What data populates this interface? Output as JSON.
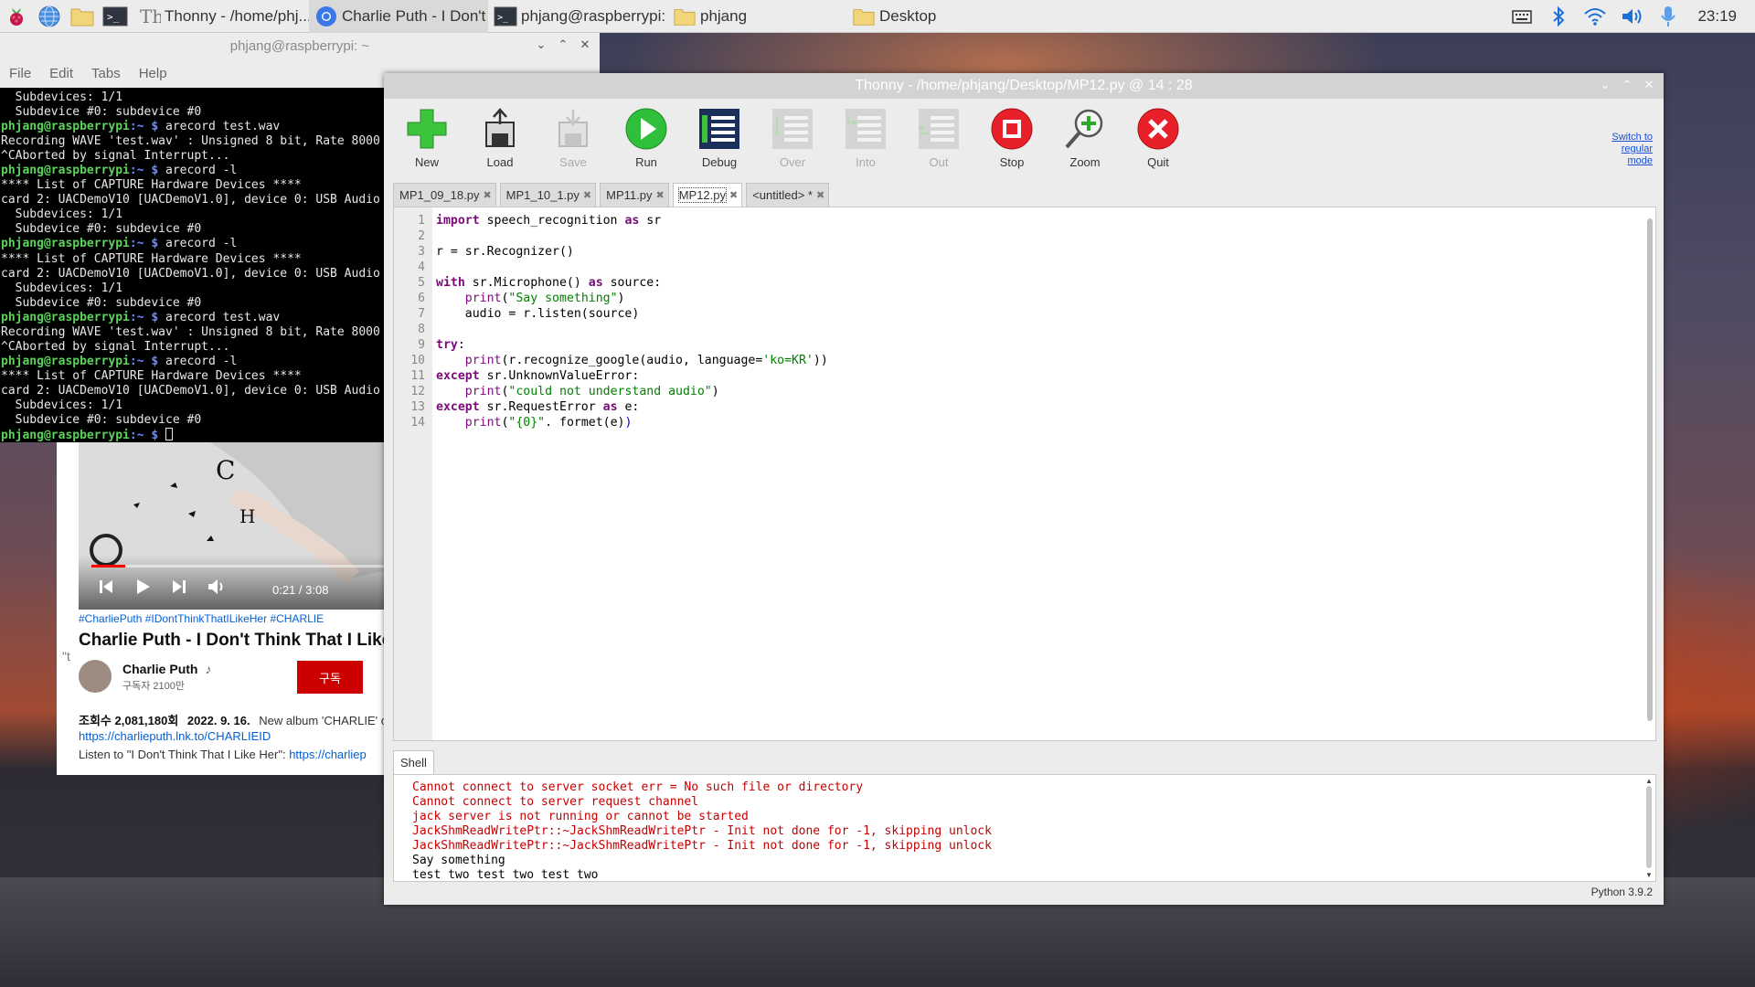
{
  "taskbar": {
    "tasks": [
      {
        "label": "Thonny  -  /home/phj..."
      },
      {
        "label": "Charlie Puth - I Don't ..."
      },
      {
        "label": "phjang@raspberrypi: ..."
      },
      {
        "label": "phjang"
      },
      {
        "label": "Desktop"
      }
    ],
    "clock": "23:19"
  },
  "terminal": {
    "title": "phjang@raspberrypi: ~",
    "menu": [
      "File",
      "Edit",
      "Tabs",
      "Help"
    ],
    "prompt_user": "phjang@raspberrypi",
    "prompt_path": ":~ $",
    "lines": [
      {
        "type": "out",
        "text": "  Subdevices: 1/1"
      },
      {
        "type": "out",
        "text": "  Subdevice #0: subdevice #0"
      },
      {
        "type": "cmd",
        "text": " arecord test.wav"
      },
      {
        "type": "out",
        "text": "Recording WAVE 'test.wav' : Unsigned 8 bit, Rate 8000"
      },
      {
        "type": "out",
        "text": "^CAborted by signal Interrupt..."
      },
      {
        "type": "cmd",
        "text": " arecord -l"
      },
      {
        "type": "out",
        "text": "**** List of CAPTURE Hardware Devices ****"
      },
      {
        "type": "out",
        "text": "card 2: UACDemoV10 [UACDemoV1.0], device 0: USB Audio"
      },
      {
        "type": "out",
        "text": "  Subdevices: 1/1"
      },
      {
        "type": "out",
        "text": "  Subdevice #0: subdevice #0"
      },
      {
        "type": "cmd",
        "text": " arecord -l"
      },
      {
        "type": "out",
        "text": "**** List of CAPTURE Hardware Devices ****"
      },
      {
        "type": "out",
        "text": "card 2: UACDemoV10 [UACDemoV1.0], device 0: USB Audio"
      },
      {
        "type": "out",
        "text": "  Subdevices: 1/1"
      },
      {
        "type": "out",
        "text": "  Subdevice #0: subdevice #0"
      },
      {
        "type": "cmd",
        "text": " arecord test.wav"
      },
      {
        "type": "out",
        "text": "Recording WAVE 'test.wav' : Unsigned 8 bit, Rate 8000"
      },
      {
        "type": "out",
        "text": "^CAborted by signal Interrupt..."
      },
      {
        "type": "cmd",
        "text": " arecord -l"
      },
      {
        "type": "out",
        "text": "**** List of CAPTURE Hardware Devices ****"
      },
      {
        "type": "out",
        "text": "card 2: UACDemoV10 [UACDemoV1.0], device 0: USB Audio"
      },
      {
        "type": "out",
        "text": "  Subdevices: 1/1"
      },
      {
        "type": "out",
        "text": "  Subdevice #0: subdevice #0"
      },
      {
        "type": "prompt",
        "text": " "
      }
    ]
  },
  "browser": {
    "video_time": "0:21 / 3:08",
    "video_progress_fraction": 0.11,
    "tags": "#CharliePuth #IDontThinkThatILikeHer #CHARLIE",
    "title": "Charlie Puth - I Don't Think That I Like H",
    "channel": "Charlie Puth",
    "channel_suffix": "♪",
    "subscribers": "구독자 2100만",
    "subscribe_label": "구독",
    "views": "조회수 2,081,180회",
    "date": "2022. 9. 16.",
    "desc_snippet": "New album 'CHARLIE' out",
    "link1": "https://charlieputh.lnk.to/CHARLIEID",
    "listen_prefix": "Listen to \"I Don't Think That I Like Her\": ",
    "link2": "https://charliep",
    "left_stub": "\"t"
  },
  "thonny": {
    "title": "Thonny  -  /home/phjang/Desktop/MP12.py  @  14 : 28",
    "switch_mode": [
      "Switch to",
      "regular",
      "mode"
    ],
    "tools": [
      {
        "label": "New",
        "icon": "new-file-icon",
        "enabled": true
      },
      {
        "label": "Load",
        "icon": "load-icon",
        "enabled": true
      },
      {
        "label": "Save",
        "icon": "save-icon",
        "enabled": false
      },
      {
        "label": "Run",
        "icon": "run-icon",
        "enabled": true
      },
      {
        "label": "Debug",
        "icon": "debug-icon",
        "enabled": true
      },
      {
        "label": "Over",
        "icon": "step-over-icon",
        "enabled": false
      },
      {
        "label": "Into",
        "icon": "step-into-icon",
        "enabled": false
      },
      {
        "label": "Out",
        "icon": "step-out-icon",
        "enabled": false
      },
      {
        "label": "Stop",
        "icon": "stop-icon",
        "enabled": true
      },
      {
        "label": "Zoom",
        "icon": "zoom-icon",
        "enabled": true
      },
      {
        "label": "Quit",
        "icon": "quit-icon",
        "enabled": true
      }
    ],
    "tabs": [
      {
        "label": "MP1_09_18.py",
        "active": false
      },
      {
        "label": "MP1_10_1.py",
        "active": false
      },
      {
        "label": "MP11.py",
        "active": false
      },
      {
        "label": "MP12.py",
        "active": true
      },
      {
        "label": "<untitled> *",
        "active": false
      }
    ],
    "line_numbers": [
      "1",
      "2",
      "3",
      "4",
      "5",
      "6",
      "7",
      "8",
      "9",
      "10",
      "11",
      "12",
      "13",
      "14"
    ],
    "shell_tab": "Shell",
    "shell_lines": [
      {
        "type": "err",
        "text": "Cannot connect to server socket err = No such file or directory"
      },
      {
        "type": "err",
        "text": "Cannot connect to server request channel"
      },
      {
        "type": "err",
        "text": "jack server is not running or cannot be started"
      },
      {
        "type": "err",
        "text": "JackShmReadWritePtr::~JackShmReadWritePtr - Init not done for -1, skipping unlock"
      },
      {
        "type": "err",
        "text": "JackShmReadWritePtr::~JackShmReadWritePtr - Init not done for -1, skipping unlock"
      },
      {
        "type": "out",
        "text": "Say something"
      },
      {
        "type": "out",
        "text": "test two test two test two"
      }
    ],
    "status": "Python 3.9.2"
  },
  "code": {
    "l1_kw1": "import",
    "l1_mod": " speech_recognition ",
    "l1_kw2": "as",
    "l1_rest": " sr",
    "l3": "r = sr.Recognizer()",
    "l5_kw1": "with",
    "l5_mid": " sr.Microphone() ",
    "l5_kw2": "as",
    "l5_rest": " source:",
    "l6_indent": "    ",
    "l6_fn": "print",
    "l6_p1": "(",
    "l6_str": "\"Say something\"",
    "l6_p2": ")",
    "l7": "    audio = r.listen(source)",
    "l9_kw": "try",
    "l9_rest": ":",
    "l10_indent": "    ",
    "l10_fn": "print",
    "l10_mid": "(r.recognize_google(audio, language=",
    "l10_str": "'ko=KR'",
    "l10_end": "))",
    "l11_kw": "except",
    "l11_rest": " sr.UnknownValueError:",
    "l12_indent": "    ",
    "l12_fn": "print",
    "l12_p1": "(",
    "l12_str": "\"could not understand audio\"",
    "l12_p2": ")",
    "l13_kw1": "except",
    "l13_mid": " sr.RequestError ",
    "l13_kw2": "as",
    "l13_rest": " e:",
    "l14_indent": "    ",
    "l14_fn": "print",
    "l14_p1": "(",
    "l14_str": "\"{0}\"",
    "l14_mid": ". formet(e)",
    "l14_p2": ")"
  }
}
